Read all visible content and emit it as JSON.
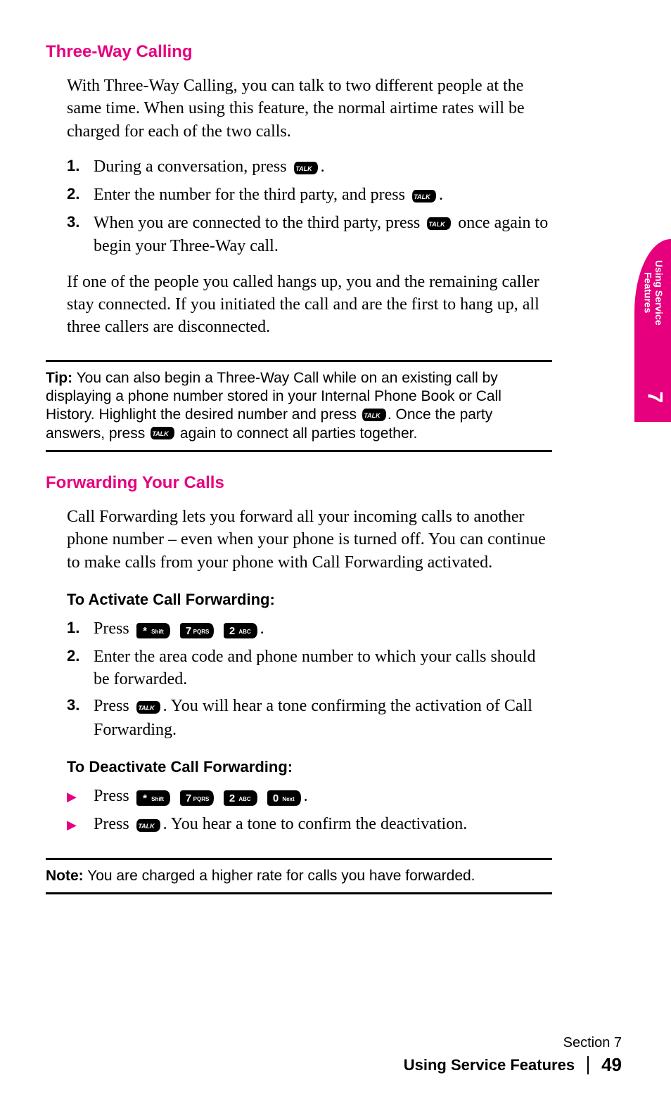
{
  "section1": {
    "heading": "Three-Way Calling",
    "intro": "With Three-Way Calling, you can talk to two different people at the same time. When using this feature, the normal airtime rates will be charged for each of the two calls.",
    "steps": [
      {
        "n": "1.",
        "before": "During a conversation, press ",
        "icons": [
          "talk"
        ],
        "after": "."
      },
      {
        "n": "2.",
        "before": "Enter the number for the third party, and press ",
        "icons": [
          "talk"
        ],
        "after": "."
      },
      {
        "n": "3.",
        "before": "When you are connected to the third party, press ",
        "icons": [
          "talk"
        ],
        "after": " once again to begin your Three-Way call."
      }
    ],
    "outro": "If one of the people you called hangs up, you and the remaining caller stay connected. If you initiated the call and are the first to hang up, all three callers are disconnected."
  },
  "tip": {
    "label": "Tip:",
    "t1": " You can also begin a Three-Way Call while on an existing call by displaying a phone number stored in your Internal Phone Book or Call History. Highlight the desired number and press ",
    "t2": ". Once the party answers, press ",
    "t3": " again to connect all parties together."
  },
  "section2": {
    "heading": "Forwarding Your Calls",
    "intro": "Call Forwarding lets you forward all your incoming calls to another phone number – even when your phone is turned off. You can continue to make calls from your phone with Call Forwarding activated.",
    "sub1": "To Activate Call Forwarding:",
    "steps1": [
      {
        "n": "1.",
        "before": "Press ",
        "icons": [
          "star",
          "7",
          "2"
        ],
        "after": "."
      },
      {
        "n": "2.",
        "before": "Enter the area code and phone number to which your calls should be forwarded.",
        "icons": [],
        "after": ""
      },
      {
        "n": "3.",
        "before": "Press ",
        "icons": [
          "talk"
        ],
        "after": ". You will hear a tone confirming the activation of Call Forwarding."
      }
    ],
    "sub2": "To Deactivate Call Forwarding:",
    "bullets": [
      {
        "before": "Press ",
        "icons": [
          "star",
          "7",
          "2",
          "0"
        ],
        "after": "."
      },
      {
        "before": "Press ",
        "icons": [
          "talk"
        ],
        "after": ". You hear a tone to confirm the deactivation."
      }
    ]
  },
  "note": {
    "label": "Note:",
    "text": " You are charged a higher rate for calls you have forwarded."
  },
  "tab": {
    "line1": "Using Service",
    "line2": "Features",
    "num": "7"
  },
  "footer": {
    "section": "Section 7",
    "title": "Using Service Features",
    "page": "49"
  },
  "keys": {
    "talk": "TALK",
    "star": {
      "big": "*",
      "small": "Shift"
    },
    "7": {
      "big": "7",
      "small": "PQRS"
    },
    "2": {
      "big": "2",
      "small": "ABC"
    },
    "0": {
      "big": "0",
      "small": "Next"
    }
  }
}
